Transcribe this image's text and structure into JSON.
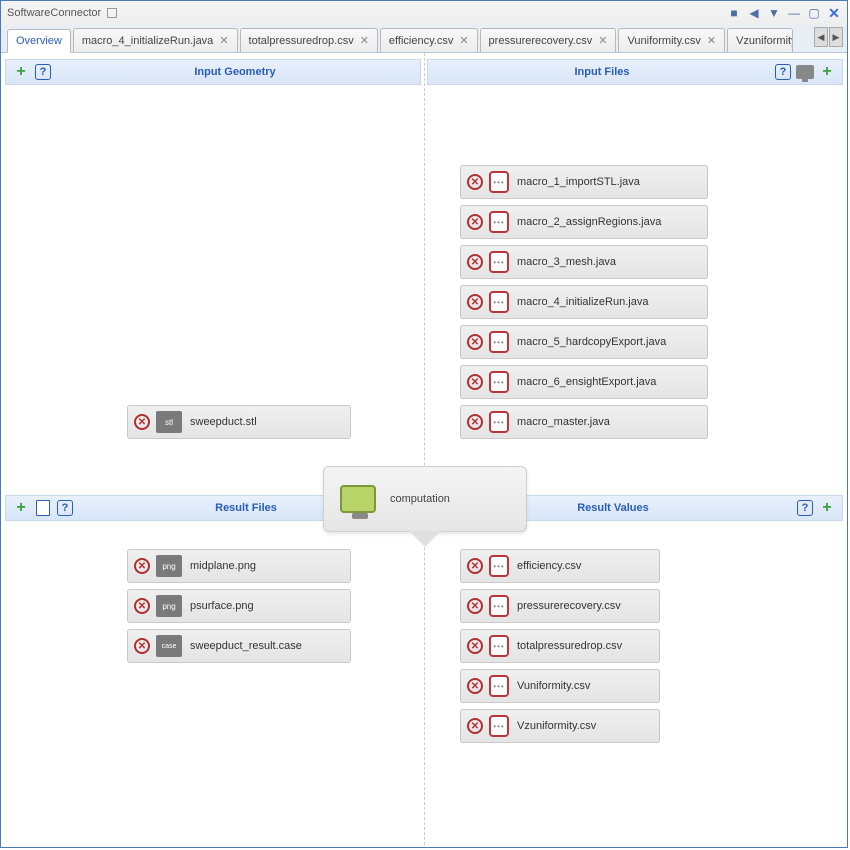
{
  "window": {
    "title": "SoftwareConnector"
  },
  "tabs": [
    {
      "label": "Overview",
      "closable": false,
      "active": true
    },
    {
      "label": "macro_4_initializeRun.java",
      "closable": true
    },
    {
      "label": "totalpressuredrop.csv",
      "closable": true
    },
    {
      "label": "efficiency.csv",
      "closable": true
    },
    {
      "label": "pressurerecovery.csv",
      "closable": true
    },
    {
      "label": "Vuniformity.csv",
      "closable": true
    },
    {
      "label": "Vzuniformity.csv",
      "closable": true
    }
  ],
  "sections": {
    "input_geometry": {
      "title": "Input Geometry"
    },
    "input_files": {
      "title": "Input Files"
    },
    "result_files": {
      "title": "Result Files"
    },
    "result_values": {
      "title": "Result Values"
    }
  },
  "computation": {
    "label": "computation"
  },
  "input_geometry_items": [
    {
      "name": "sweepduct.stl",
      "thumb": "stl"
    }
  ],
  "input_files_items": [
    {
      "name": "macro_1_importSTL.java"
    },
    {
      "name": "macro_2_assignRegions.java"
    },
    {
      "name": "macro_3_mesh.java"
    },
    {
      "name": "macro_4_initializeRun.java"
    },
    {
      "name": "macro_5_hardcopyExport.java"
    },
    {
      "name": "macro_6_ensightExport.java"
    },
    {
      "name": "macro_master.java"
    }
  ],
  "result_files_items": [
    {
      "name": "midplane.png",
      "thumb": "png"
    },
    {
      "name": "psurface.png",
      "thumb": "png"
    },
    {
      "name": "sweepduct_result.case",
      "thumb": "case"
    }
  ],
  "result_values_items": [
    {
      "name": "efficiency.csv"
    },
    {
      "name": "pressurerecovery.csv"
    },
    {
      "name": "totalpressuredrop.csv"
    },
    {
      "name": "Vuniformity.csv"
    },
    {
      "name": "Vzuniformity.csv"
    }
  ]
}
